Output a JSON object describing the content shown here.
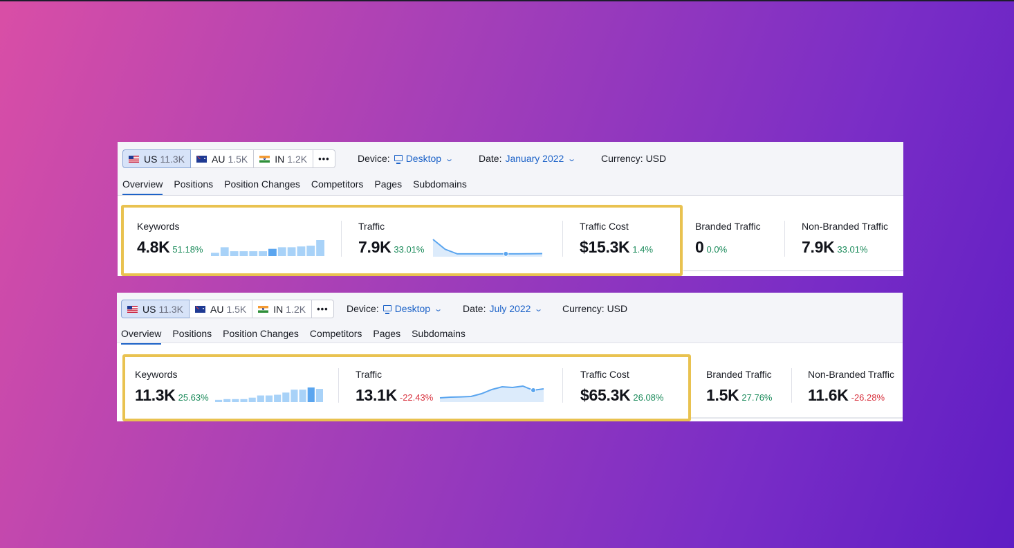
{
  "colors": {
    "accent_blue": "#1d63c8",
    "positive_green": "#1a8a5a",
    "negative_red": "#d8333f",
    "highlight_yellow": "#e9c250",
    "bar_blue": "#a8d2f8",
    "bar_dark_blue": "#5aa5ef"
  },
  "panels": [
    {
      "databases": [
        {
          "flag": "us-flag-icon",
          "code": "US",
          "count": "11.3K",
          "active": true
        },
        {
          "flag": "au-flag-icon",
          "code": "AU",
          "count": "1.5K",
          "active": false
        },
        {
          "flag": "in-flag-icon",
          "code": "IN",
          "count": "1.2K",
          "active": false
        }
      ],
      "more_label": "•••",
      "device_label": "Device:",
      "device_value": "Desktop",
      "date_label": "Date:",
      "date_value": "January 2022",
      "currency_label": "Currency: USD",
      "tabs": [
        "Overview",
        "Positions",
        "Position Changes",
        "Competitors",
        "Pages",
        "Subdomains"
      ],
      "active_tab": "Overview",
      "kpis": {
        "keywords": {
          "label": "Keywords",
          "value": "4.8K",
          "change": "51.18%",
          "trend": "positive"
        },
        "traffic": {
          "label": "Traffic",
          "value": "7.9K",
          "change": "33.01%",
          "trend": "positive"
        },
        "traffic_cost": {
          "label": "Traffic Cost",
          "value": "$15.3K",
          "change": "1.4%",
          "trend": "positive"
        },
        "branded": {
          "label": "Branded Traffic",
          "value": "0",
          "change": "0.0%",
          "trend": "positive"
        },
        "non_branded": {
          "label": "Non-Branded Traffic",
          "value": "7.9K",
          "change": "33.01%",
          "trend": "positive"
        }
      },
      "keywords_bars": [
        0.2,
        0.55,
        0.3,
        0.3,
        0.3,
        0.3,
        0.45,
        0.55,
        0.55,
        0.6,
        0.65,
        1.0
      ],
      "keywords_highlight_bar": 6,
      "traffic_line": [
        1.0,
        0.35,
        0.05,
        0.05,
        0.05,
        0.05,
        0.05,
        0.05,
        0.06,
        0.07
      ],
      "traffic_marker_index": 6
    },
    {
      "databases": [
        {
          "flag": "us-flag-icon",
          "code": "US",
          "count": "11.3K",
          "active": true
        },
        {
          "flag": "au-flag-icon",
          "code": "AU",
          "count": "1.5K",
          "active": false
        },
        {
          "flag": "in-flag-icon",
          "code": "IN",
          "count": "1.2K",
          "active": false
        }
      ],
      "more_label": "•••",
      "device_label": "Device:",
      "device_value": "Desktop",
      "date_label": "Date:",
      "date_value": "July 2022",
      "currency_label": "Currency: USD",
      "tabs": [
        "Overview",
        "Positions",
        "Position Changes",
        "Competitors",
        "Pages",
        "Subdomains"
      ],
      "active_tab": "Overview",
      "kpis": {
        "keywords": {
          "label": "Keywords",
          "value": "11.3K",
          "change": "25.63%",
          "trend": "positive"
        },
        "traffic": {
          "label": "Traffic",
          "value": "13.1K",
          "change": "-22.43%",
          "trend": "negative"
        },
        "traffic_cost": {
          "label": "Traffic Cost",
          "value": "$65.3K",
          "change": "26.08%",
          "trend": "positive"
        },
        "branded": {
          "label": "Branded Traffic",
          "value": "1.5K",
          "change": "27.76%",
          "trend": "positive"
        },
        "non_branded": {
          "label": "Non-Branded Traffic",
          "value": "11.6K",
          "change": "-26.28%",
          "trend": "negative"
        }
      },
      "keywords_bars": [
        0.15,
        0.2,
        0.2,
        0.2,
        0.3,
        0.45,
        0.45,
        0.5,
        0.65,
        0.85,
        0.85,
        1.0,
        0.9
      ],
      "keywords_highlight_bar": 11,
      "traffic_line": [
        0.15,
        0.2,
        0.22,
        0.25,
        0.45,
        0.75,
        0.95,
        0.9,
        1.0,
        0.7,
        0.8
      ],
      "traffic_marker_index": 9
    }
  ]
}
